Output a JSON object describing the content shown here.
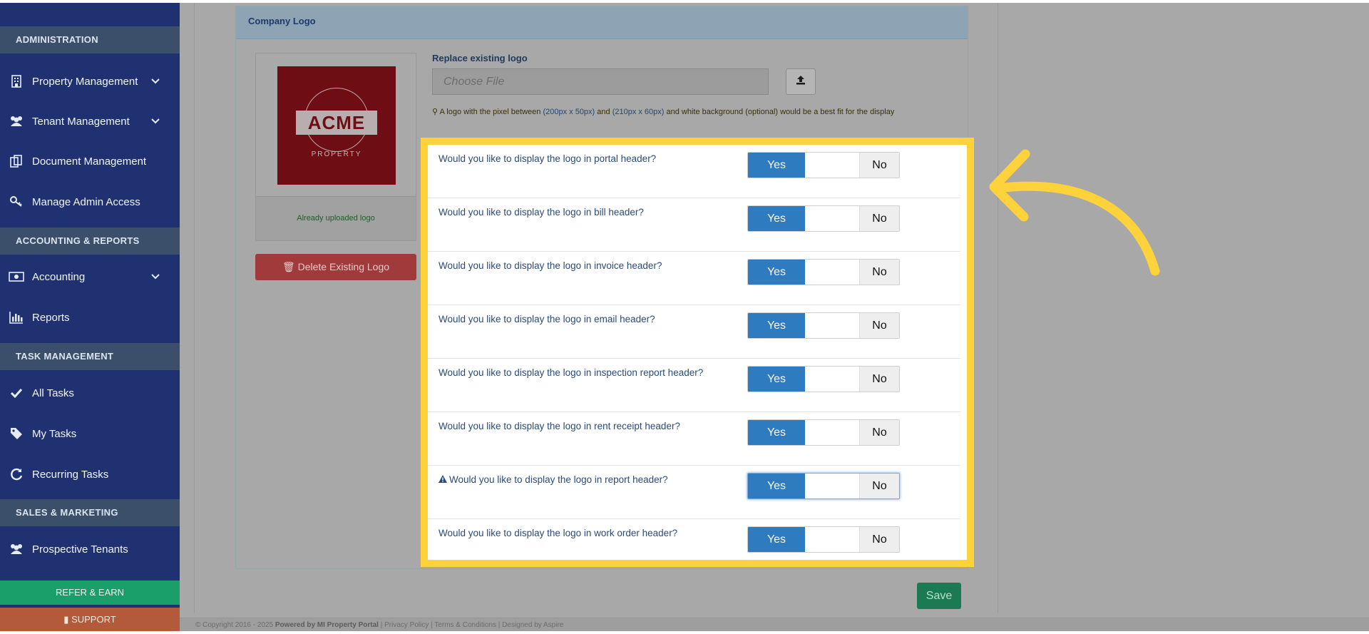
{
  "sidebar": {
    "sections": {
      "administration": "ADMINISTRATION",
      "accounting": "ACCOUNTING & REPORTS",
      "task": "TASK MANAGEMENT",
      "sales": "SALES & MARKETING"
    },
    "items": {
      "property_management": "Property Management",
      "tenant_management": "Tenant Management",
      "document_management": "Document Management",
      "manage_admin_access": "Manage Admin Access",
      "accounting": "Accounting",
      "reports": "Reports",
      "all_tasks": "All Tasks",
      "my_tasks": "My Tasks",
      "recurring_tasks": "Recurring Tasks",
      "prospective_tenants": "Prospective Tenants"
    },
    "refer_earn": "REFER & EARN",
    "support": "SUPPORT"
  },
  "card": {
    "title": "Company Logo",
    "logo_text": "ACME",
    "logo_subtext": "PROPERTY",
    "logo_caption": "Already uploaded logo",
    "delete_label": "Delete Existing Logo",
    "replace_label": "Replace existing logo",
    "file_placeholder": "Choose File",
    "hint_prefix": "A logo with the pixel between ",
    "hint_size1": "(200px x 50px)",
    "hint_and": " and ",
    "hint_size2": "(210px x 60px)",
    "hint_suffix": " and white background (optional) would be a best fit for the display"
  },
  "toggles": {
    "yes": "Yes",
    "no": "No",
    "questions": [
      "Would you like to display the logo in portal header?",
      "Would you like to display the logo in bill header?",
      "Would you like to display the logo in invoice header?",
      "Would you like to display the logo in email header?",
      "Would you like to display the logo in inspection report header?",
      "Would you like to display the logo in rent receipt header?",
      "Would you like to display the logo in report header?",
      "Would you like to display the logo in work order header?"
    ]
  },
  "save_label": "Save",
  "footer": {
    "copyright": "© Copyright 2016 - 2025",
    "powered": "Powered by MI Property Portal",
    "links": "| Privacy Policy | Terms & Conditions",
    "designed": "| Designed by Aspire"
  },
  "colors": {
    "sidebar_bg": "#1f3171",
    "highlight": "#fdd23a",
    "toggle_yes": "#2e7bc0",
    "save": "#1b7a53"
  }
}
